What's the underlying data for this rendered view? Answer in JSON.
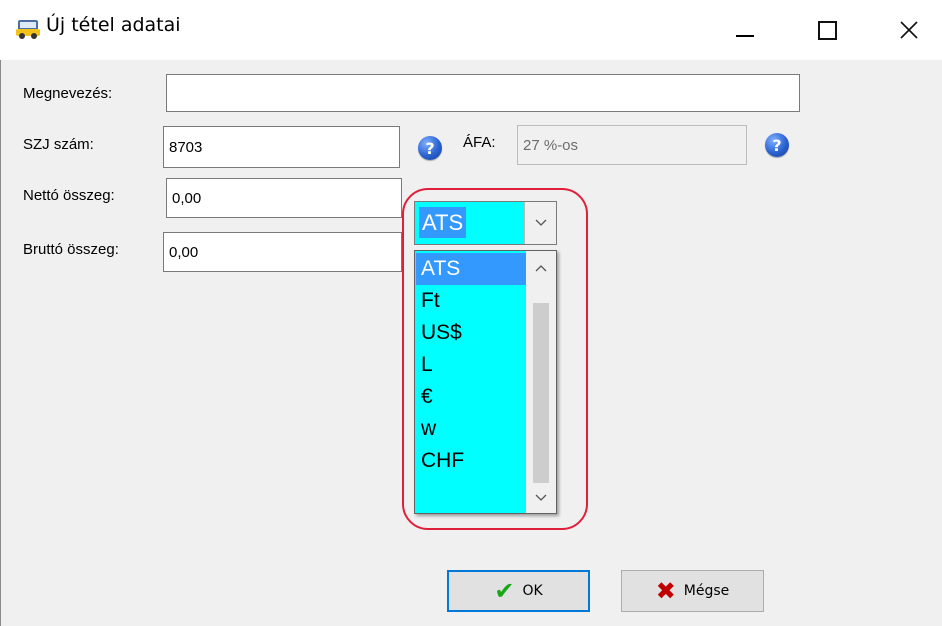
{
  "window": {
    "title": "Új tétel adatai",
    "icon": "car-icon"
  },
  "form": {
    "name_label": "Megnevezés:",
    "name_value": "",
    "szj_label": "SZJ szám:",
    "szj_value": "8703",
    "afa_label": "ÁFA:",
    "afa_value": "27 %-os",
    "netto_label": "Nettó összeg:",
    "netto_value": "0,00",
    "brutto_label": "Bruttó összeg:",
    "brutto_value": "0,00",
    "help_glyph": "?"
  },
  "currency": {
    "selected": "ATS",
    "options": [
      "ATS",
      "Ft",
      "US$",
      "L",
      "€",
      "w",
      "CHF"
    ],
    "background_color": "#00ffff",
    "selection_color": "#3399ff"
  },
  "buttons": {
    "ok_label": "OK",
    "cancel_label": "Mégse"
  },
  "colors": {
    "highlight": "#e0203a",
    "default_button_border": "#0078d7"
  }
}
